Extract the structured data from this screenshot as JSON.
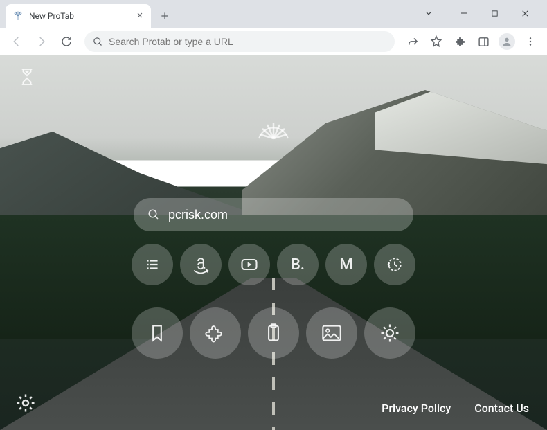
{
  "window": {
    "tab_title": "New ProTab"
  },
  "omnibox": {
    "placeholder": "Search Protab or type a URL"
  },
  "page": {
    "search_value": "pcrisk.com",
    "quick_links_row1": [
      {
        "name": "list-icon"
      },
      {
        "name": "amazon-icon"
      },
      {
        "name": "youtube-icon"
      },
      {
        "name": "booking-icon",
        "letter": "B."
      },
      {
        "name": "gmail-icon",
        "letter": "M"
      },
      {
        "name": "history-icon"
      }
    ],
    "quick_links_row2": [
      {
        "name": "bookmark-icon"
      },
      {
        "name": "puzzle-icon"
      },
      {
        "name": "clipboard-icon"
      },
      {
        "name": "image-icon"
      },
      {
        "name": "brightness-icon"
      }
    ],
    "footer": {
      "privacy": "Privacy Policy",
      "contact": "Contact Us"
    }
  }
}
